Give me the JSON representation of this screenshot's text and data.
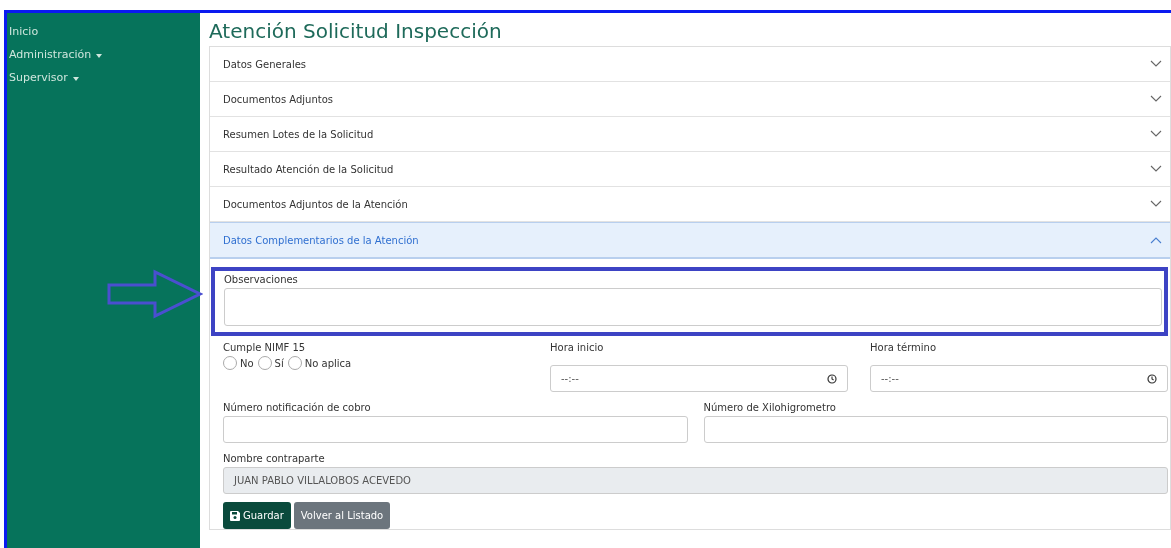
{
  "sidebar": {
    "items": [
      {
        "label": "Inicio",
        "dropdown": false
      },
      {
        "label": "Administración",
        "dropdown": true
      },
      {
        "label": "Supervisor",
        "dropdown": true
      }
    ]
  },
  "title": "Atención Solicitud Inspección",
  "accordion": [
    {
      "label": "Datos Generales",
      "expanded": false
    },
    {
      "label": "Documentos Adjuntos",
      "expanded": false
    },
    {
      "label": "Resumen Lotes de la Solicitud",
      "expanded": false
    },
    {
      "label": "Resultado Atención de la Solicitud",
      "expanded": false
    },
    {
      "label": "Documentos Adjuntos de la Atención",
      "expanded": false
    },
    {
      "label": "Datos Complementarios de la Atención",
      "expanded": true
    }
  ],
  "form": {
    "observaciones": {
      "label": "Observaciones"
    },
    "cumple": {
      "label": "Cumple NIMF 15",
      "options": [
        {
          "label": "No",
          "selected": false
        },
        {
          "label": "Sí",
          "selected": false
        },
        {
          "label": "No aplica",
          "selected": false
        }
      ]
    },
    "hora_inicio": {
      "label": "Hora inicio",
      "placeholder": "--:--"
    },
    "hora_termino": {
      "label": "Hora término",
      "placeholder": "--:--"
    },
    "notificacion": {
      "label": "Número notificación de cobro"
    },
    "xilohigrometro": {
      "label": "Número de Xilohigrometro"
    },
    "contraparte": {
      "label": "Nombre contraparte",
      "value": "JUAN PABLO VILLALOBOS ACEVEDO",
      "disabled": true
    }
  },
  "buttons": [
    {
      "label": "Guardar",
      "kind": "primary"
    },
    {
      "label": "Volver al Listado",
      "kind": "secondary"
    }
  ]
}
